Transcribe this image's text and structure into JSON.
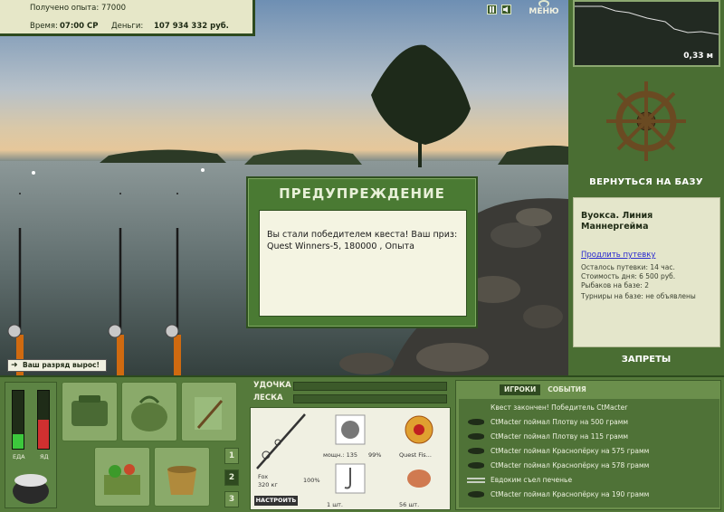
{
  "status": {
    "exp_label": "Получено опыта:",
    "exp_value": "77000",
    "time_label": "Время:",
    "time_value": "07:00 СР",
    "money_label": "Деньги:",
    "money_value": "107 934 332 руб."
  },
  "controls": {
    "menu_label": "МЕНЮ",
    "pause_icon": "pause-icon",
    "sound_icon": "sound-icon"
  },
  "depth": {
    "value": "0,33 м"
  },
  "right": {
    "back_to_base": "ВЕРНУТЬСЯ НА БАЗУ",
    "location": "Вуокса. Линия Маннергейма",
    "extend_link": "Продлить путевку",
    "info": [
      "Осталось путевки: 14 час.",
      "Стоимость дня: 6 500 руб.",
      "Рыбаков на базе: 2",
      "Турниры на базе: не объявлены"
    ],
    "bans": "ЗАПРЕТЫ"
  },
  "modal": {
    "title": "ПРЕДУПРЕЖДЕНИЕ",
    "line1": "Вы стали победителем квеста! Ваш приз:",
    "line2": "Quest Winners-5, 180000 , Опыта"
  },
  "rank_badge": "Ваш разряд вырос!",
  "meters": {
    "food_label": "ЕДА",
    "poison_label": "ЯД",
    "food_level": 0.25,
    "poison_level": 0.5
  },
  "pages": [
    "1",
    "2",
    "3"
  ],
  "tackle": {
    "rod_label": "УДОЧКА",
    "line_label": "ЛЕСКА",
    "rod_name": "Fox",
    "rod_weight": "320 кг",
    "rod_percent": "100%",
    "reel_power": "мощн.: 135",
    "reel_percent": "99%",
    "line_name": "Quest Fis...",
    "hook_count": "1 шт.",
    "bait_count": "56 шт.",
    "tune_button": "НАСТРОИТЬ"
  },
  "log": {
    "tabs": [
      "ИГРОКИ",
      "СОБЫТИЯ"
    ],
    "entries": [
      {
        "icon": "none",
        "text": "Квест закончен! Победитель CtMacter"
      },
      {
        "icon": "fish-icon",
        "text": "CtMacter поймал Плотву на 500 грамм"
      },
      {
        "icon": "fish-icon",
        "text": "CtMacter поймал Плотву на 115 грамм"
      },
      {
        "icon": "fish-icon",
        "text": "CtMacter поймал Краснопёрку на 575 грамм"
      },
      {
        "icon": "fish-icon",
        "text": "CtMacter поймал Краснопёрку на 578 грамм"
      },
      {
        "icon": "cutlery-icon",
        "text": "Евдоким съел печенье"
      },
      {
        "icon": "fish-icon",
        "text": "CtMacter поймал Краснопёрку на 190 грамм"
      }
    ]
  }
}
